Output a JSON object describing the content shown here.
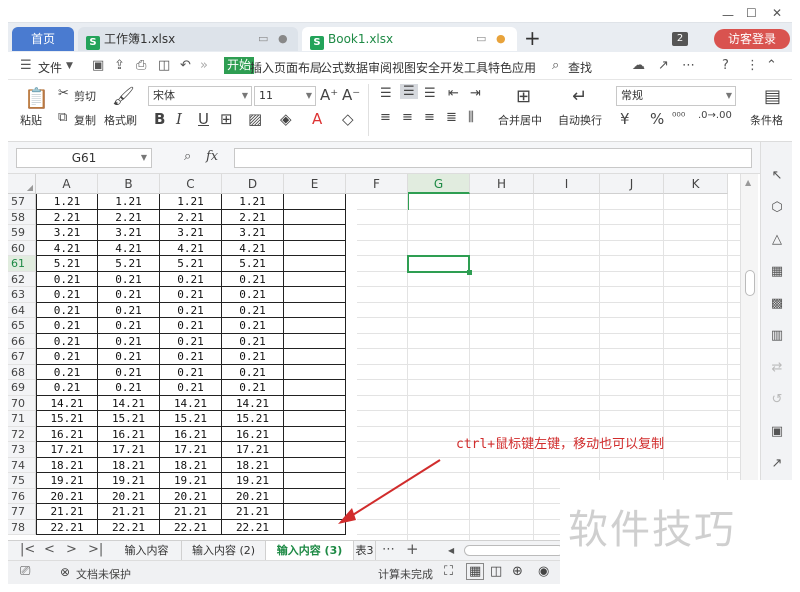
{
  "tabs": {
    "home": "首页",
    "doc1": "工作簿1.xlsx",
    "doc2": "Book1.xlsx",
    "add": "+",
    "badge": "2",
    "login": "访客登录"
  },
  "menu": {
    "file": "文件",
    "items": [
      "开始",
      "插入",
      "页面布局",
      "公式",
      "数据",
      "审阅",
      "视图",
      "安全",
      "开发工具",
      "特色应用"
    ],
    "search": "查找"
  },
  "ribbon": {
    "paste": "粘贴",
    "cut": "剪切",
    "copy": "复制",
    "format_painter": "格式刷",
    "font_name": "宋体",
    "font_size": "11",
    "merge": "合并居中",
    "wrap": "自动换行",
    "number_format": "常规",
    "cond_format": "条件格"
  },
  "formula_bar": {
    "name_box": "G61",
    "fx": "fx"
  },
  "columns": [
    "A",
    "B",
    "C",
    "D",
    "E",
    "F",
    "G",
    "H",
    "I",
    "J",
    "K"
  ],
  "selected_column": "G",
  "rows": [
    {
      "n": "57",
      "v": "1.21"
    },
    {
      "n": "58",
      "v": "2.21"
    },
    {
      "n": "59",
      "v": "3.21"
    },
    {
      "n": "60",
      "v": "4.21"
    },
    {
      "n": "61",
      "v": "5.21"
    },
    {
      "n": "62",
      "v": "0.21"
    },
    {
      "n": "63",
      "v": "0.21"
    },
    {
      "n": "64",
      "v": "0.21"
    },
    {
      "n": "65",
      "v": "0.21"
    },
    {
      "n": "66",
      "v": "0.21"
    },
    {
      "n": "67",
      "v": "0.21"
    },
    {
      "n": "68",
      "v": "0.21"
    },
    {
      "n": "69",
      "v": "0.21"
    },
    {
      "n": "70",
      "v": "14.21"
    },
    {
      "n": "71",
      "v": "15.21"
    },
    {
      "n": "72",
      "v": "16.21"
    },
    {
      "n": "73",
      "v": "17.21"
    },
    {
      "n": "74",
      "v": "18.21"
    },
    {
      "n": "75",
      "v": "19.21"
    },
    {
      "n": "76",
      "v": "20.21"
    },
    {
      "n": "77",
      "v": "21.21"
    },
    {
      "n": "78",
      "v": "22.21"
    }
  ],
  "selected_row": "61",
  "sheets": [
    "输入内容",
    "输入内容 (2)",
    "输入内容 (3)",
    "表3"
  ],
  "active_sheet": "输入内容 (3)",
  "status": {
    "protect": "文档未保护",
    "calc": "计算未完成"
  },
  "annotation": "ctrl+鼠标键左键，移动也可以复制",
  "watermark": "软件技巧",
  "colors": {
    "accent": "#2e9e52",
    "home_tab": "#4a7bd0",
    "login": "#d9534f",
    "annotation": "#d12c2c"
  }
}
